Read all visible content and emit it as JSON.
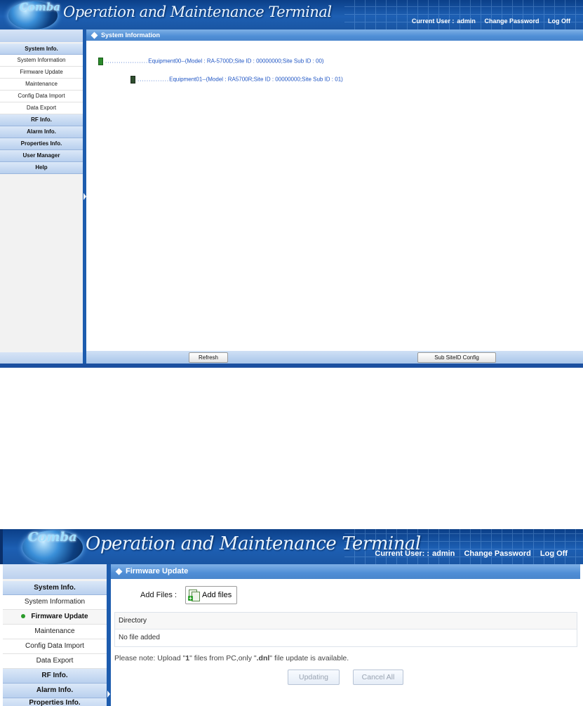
{
  "app": {
    "logo_text": "Comba",
    "title": "Operation and Maintenance Terminal",
    "current_user_label": "Current User :",
    "current_user_value": "admin",
    "change_password": "Change Password",
    "log_off": "Log Off"
  },
  "screen1": {
    "sidebar": {
      "sections": [
        {
          "label": "System Info.",
          "items": [
            "System Information",
            "Firmware Update",
            "Maintenance",
            "Config Data Import",
            "Data Export"
          ]
        },
        {
          "label": "RF Info."
        },
        {
          "label": "Alarm Info."
        },
        {
          "label": "Properties Info."
        },
        {
          "label": "User Manager"
        },
        {
          "label": "Help"
        }
      ]
    },
    "content_title": "System Information",
    "tree": [
      {
        "dots": "...................",
        "text": "Equipment00--(Model : RA-5700D;Site ID : 00000000;Site Sub ID : 00)"
      },
      {
        "dots": "..............",
        "text": "Equipment01--(Model : RA5700R;Site ID : 00000000;Site Sub ID : 01)"
      }
    ],
    "buttons": {
      "refresh": "Refresh",
      "sub_siteid_config": "Sub SiteID Config"
    }
  },
  "screen2": {
    "app": {
      "current_user_label": "Current User: :",
      "current_user_value": "admin"
    },
    "sidebar": {
      "sections": [
        {
          "label": "System Info.",
          "items": [
            "System Information",
            "Firmware Update",
            "Maintenance",
            "Config Data Import",
            "Data Export"
          ],
          "active_item": "Firmware Update"
        },
        {
          "label": "RF Info."
        },
        {
          "label": "Alarm Info."
        },
        {
          "label": "Properties Info."
        }
      ]
    },
    "content_title": "Firmware Update",
    "add_files_label": "Add Files :",
    "add_files_button": "Add files",
    "table": {
      "header": "Directory",
      "empty_text": "No file added"
    },
    "note": {
      "prefix": "Please note: Upload \"",
      "count": "1",
      "middle": "\" files from PC,only \"",
      "ext": ".dnl",
      "suffix": "\" file update is available."
    },
    "buttons": {
      "updating": "Updating",
      "cancel_all": "Cancel All"
    }
  }
}
